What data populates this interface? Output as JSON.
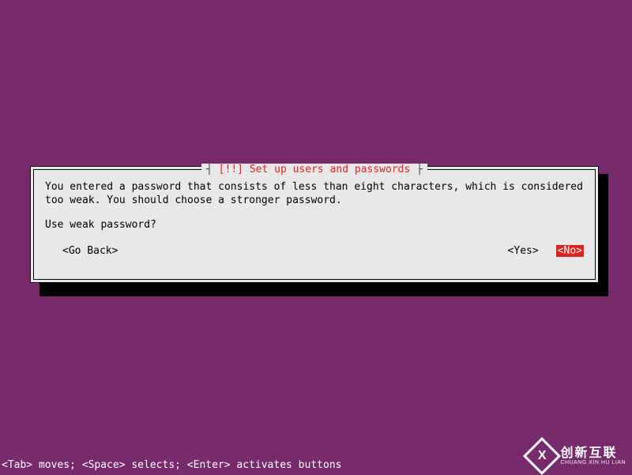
{
  "dialog": {
    "title_prefix": "[!!]",
    "title_text": "Set up users and passwords",
    "body": "You entered a password that consists of less than eight characters, which is considered too weak. You should choose a stronger password.",
    "prompt": "Use weak password?",
    "buttons": {
      "go_back": "<Go Back>",
      "yes": "<Yes>",
      "no": "<No>"
    }
  },
  "statusbar": "<Tab> moves; <Space> selects; <Enter> activates buttons",
  "watermark": {
    "logo_letter": "X",
    "cn": "创新互联",
    "en": "CHUANG XIN HU LIAN"
  },
  "colors": {
    "background": "#772b6d",
    "highlight": "#d22",
    "panel": "#e8e8e8"
  }
}
